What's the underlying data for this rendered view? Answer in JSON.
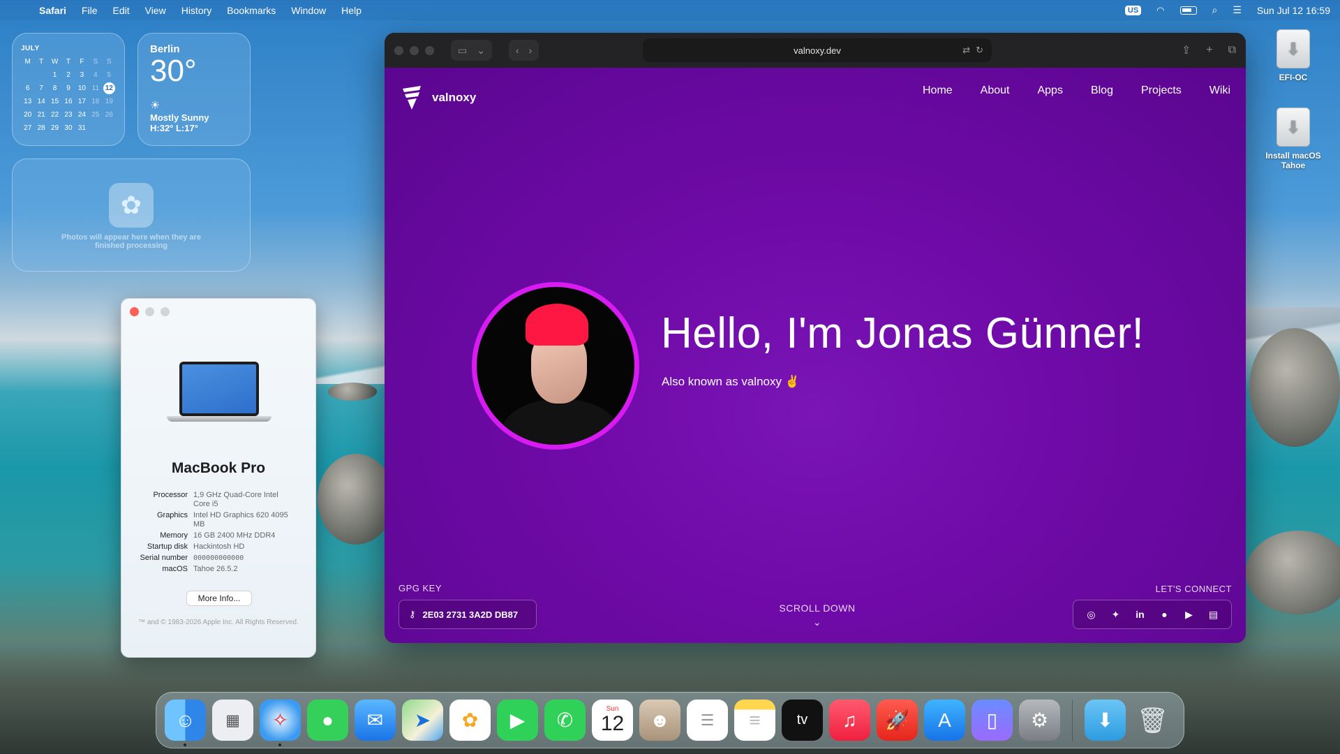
{
  "menubar": {
    "app": "Safari",
    "items": [
      "File",
      "Edit",
      "View",
      "History",
      "Bookmarks",
      "Window",
      "Help"
    ],
    "keyboard": "US",
    "clock": "Sun Jul 12  16:59"
  },
  "calendar": {
    "month": "JULY",
    "weekdays": [
      "M",
      "T",
      "W",
      "T",
      "F",
      "S",
      "S"
    ],
    "weeks": [
      [
        "",
        "",
        "1",
        "2",
        "3",
        "4",
        "5"
      ],
      [
        "6",
        "7",
        "8",
        "9",
        "10",
        "11",
        "12"
      ],
      [
        "13",
        "14",
        "15",
        "16",
        "17",
        "18",
        "19"
      ],
      [
        "20",
        "21",
        "22",
        "23",
        "24",
        "25",
        "26"
      ],
      [
        "27",
        "28",
        "29",
        "30",
        "31",
        "",
        ""
      ]
    ],
    "today": "12"
  },
  "weather": {
    "city": "Berlin",
    "temp": "30°",
    "condition": "Mostly Sunny",
    "high_low": "H:32° L:17°"
  },
  "photos_widget": {
    "message": "Photos will appear here when they are finished processing"
  },
  "about_mac": {
    "model": "MacBook Pro",
    "specs": [
      {
        "key": "Processor",
        "value": "1,9 GHz Quad-Core Intel Core i5"
      },
      {
        "key": "Graphics",
        "value": "Intel HD Graphics 620 4095 MB"
      },
      {
        "key": "Memory",
        "value": "16 GB 2400 MHz DDR4"
      },
      {
        "key": "Startup disk",
        "value": "Hackintosh HD"
      },
      {
        "key": "Serial number",
        "value": "000000000000"
      },
      {
        "key": "macOS",
        "value": "Tahoe 26.5.2"
      }
    ],
    "more_info_label": "More Info...",
    "copyright": "™ and © 1983-2026 Apple Inc. All Rights Reserved."
  },
  "safari": {
    "url": "valnoxy.dev"
  },
  "website": {
    "brand": "valnoxy",
    "nav": [
      "Home",
      "About",
      "Apps",
      "Blog",
      "Projects",
      "Wiki"
    ],
    "headline": "Hello, I'm Jonas Günner!",
    "subline": "Also known as valnoxy ✌️",
    "gpg_label": "GPG KEY",
    "gpg_key": "2E03 2731 3A2D DB87",
    "scroll_label": "SCROLL DOWN",
    "connect_label": "LET'S CONNECT",
    "social_icons": [
      "instagram-icon",
      "twitter-icon",
      "linkedin-icon",
      "github-icon",
      "youtube-icon",
      "twitch-icon"
    ],
    "accent_color": "#d81bf0"
  },
  "desktop_icons": [
    {
      "label": "EFI-OC"
    },
    {
      "label": "Install macOS Tahoe"
    }
  ],
  "dock": {
    "calendar_day": "Sun",
    "calendar_date": "12",
    "apps": [
      "Finder",
      "Launchpad",
      "Safari",
      "Messages",
      "Mail",
      "Maps",
      "Photos",
      "FaceTime",
      "Phone",
      "Calendar",
      "Contacts",
      "Reminders",
      "Notes",
      "TV",
      "Music",
      "Rocket",
      "App Store",
      "iPhone Mirroring",
      "System Settings",
      "Downloads",
      "Trash"
    ]
  }
}
